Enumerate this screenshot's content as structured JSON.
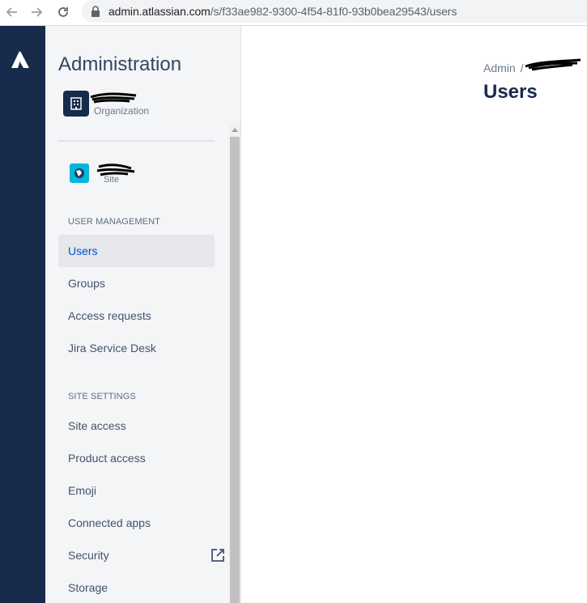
{
  "browser": {
    "url_domain": "admin.atlassian.com",
    "url_path": "/s/f33ae982-9300-4f54-81f0-93b0bea29543/users"
  },
  "sidebar": {
    "title": "Administration",
    "org_label": "Organization",
    "site_label": "Site",
    "sections": [
      {
        "heading": "USER MANAGEMENT",
        "items": [
          {
            "label": "Users",
            "active": true
          },
          {
            "label": "Groups"
          },
          {
            "label": "Access requests"
          },
          {
            "label": "Jira Service Desk"
          }
        ]
      },
      {
        "heading": "SITE SETTINGS",
        "items": [
          {
            "label": "Site access"
          },
          {
            "label": "Product access"
          },
          {
            "label": "Emoji"
          },
          {
            "label": "Connected apps"
          },
          {
            "label": "Security"
          },
          {
            "label": "Storage"
          }
        ]
      }
    ]
  },
  "main": {
    "breadcrumb_root": "Admin",
    "breadcrumb_sep": "/",
    "title": "Users"
  },
  "colors": {
    "global_nav": "#172b4d",
    "sidebar_bg": "#f4f5f7",
    "active_text": "#0052cc",
    "site_icon": "#00b8d9"
  },
  "icons": [
    "back-arrow-icon",
    "forward-arrow-icon",
    "reload-icon",
    "lock-icon",
    "atlassian-logo-icon",
    "building-icon",
    "site-globe-icon",
    "external-link-icon"
  ]
}
